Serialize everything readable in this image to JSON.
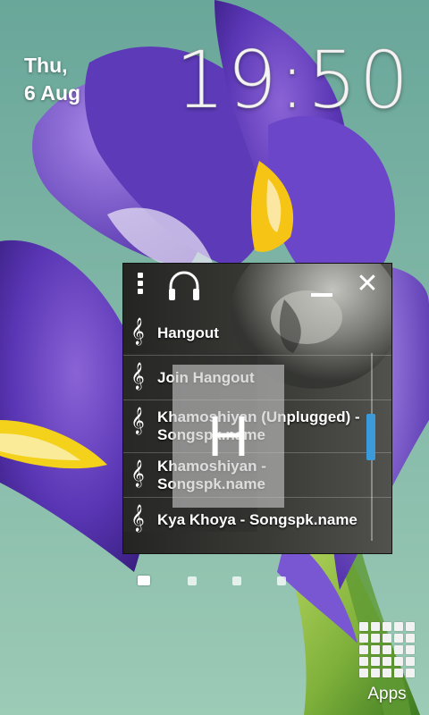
{
  "clock": {
    "day": "Thu,",
    "date": "6 Aug",
    "time": "19:50"
  },
  "widget": {
    "songs": [
      {
        "title": "Hangout"
      },
      {
        "title": "Join Hangout"
      },
      {
        "title": "Khamoshiyan (Unplugged) - Songspk.name"
      },
      {
        "title": "Khamoshiyan - Songspk.name"
      },
      {
        "title": "Kya Khoya - Songspk.name"
      }
    ],
    "index_letter": "H",
    "accent_color": "#3b9ad9"
  },
  "home": {
    "pages": 4,
    "current_page": 1,
    "apps_label": "Apps"
  }
}
